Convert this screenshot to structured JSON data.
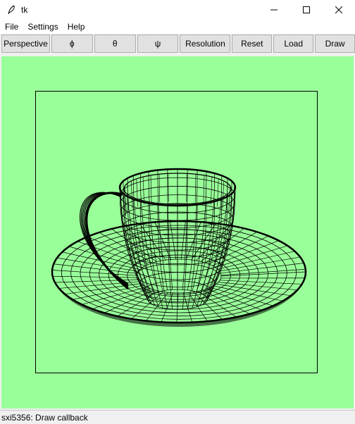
{
  "window": {
    "title": "tk",
    "controls": {
      "minimize_icon": "minimize-icon",
      "maximize_icon": "maximize-icon",
      "close_icon": "close-icon"
    }
  },
  "menubar": {
    "items": [
      "File",
      "Settings",
      "Help"
    ]
  },
  "toolbar": {
    "buttons": [
      "Perspective",
      "ϕ",
      "θ",
      "ψ",
      "Resolution",
      "Reset",
      "Load",
      "Draw"
    ]
  },
  "canvas": {
    "background": "#99ff99",
    "content": "teacup-wireframe",
    "line_color": "#000000"
  },
  "status": {
    "text": "sxi5356: Draw callback"
  }
}
